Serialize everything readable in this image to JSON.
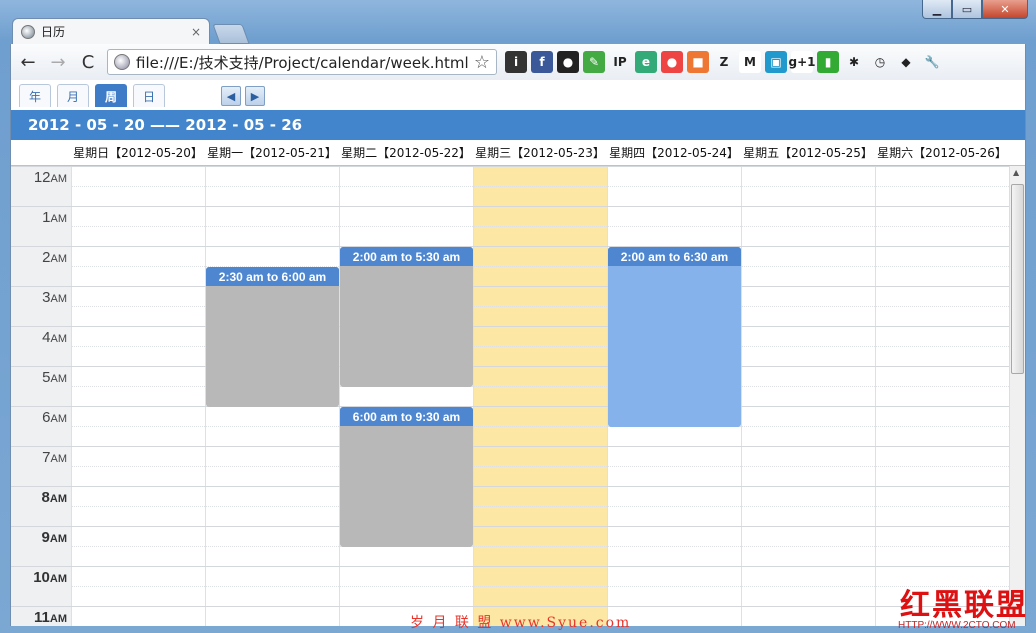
{
  "browser": {
    "tab_title": "日历",
    "tab_close": "×",
    "url": "file:///E:/技术支持/Project/calendar/week.html",
    "back": "←",
    "forward": "→",
    "reload": "C",
    "star": "☆",
    "window_min": "▁",
    "window_max": "▭",
    "window_close": "✕",
    "extensions": [
      {
        "name": "i-icon",
        "text": "i",
        "bg": "#333"
      },
      {
        "name": "f-counter-icon",
        "text": "f",
        "bg": "#3b5998"
      },
      {
        "name": "camera-icon",
        "text": "●",
        "bg": "#222"
      },
      {
        "name": "edit-icon",
        "text": "✎",
        "bg": "#4a4"
      },
      {
        "name": "ip-icon",
        "text": "IP",
        "bg": "transparent"
      },
      {
        "name": "ie-icon",
        "text": "e",
        "bg": "#3a7"
      },
      {
        "name": "record-icon",
        "text": "●",
        "bg": "#e44"
      },
      {
        "name": "color-icon",
        "text": "■",
        "bg": "#e73"
      },
      {
        "name": "z-icon",
        "text": "Z",
        "bg": "transparent"
      },
      {
        "name": "gmail-icon",
        "text": "M",
        "bg": "#fff"
      },
      {
        "name": "calendar-icon",
        "text": "▣",
        "bg": "#29c"
      },
      {
        "name": "gplus-icon",
        "text": "g+1",
        "bg": "#fff"
      },
      {
        "name": "battery-icon",
        "text": "▮",
        "bg": "#3a3"
      },
      {
        "name": "bug-icon",
        "text": "✱",
        "bg": "transparent"
      },
      {
        "name": "timer-icon",
        "text": "◷",
        "bg": "transparent"
      },
      {
        "name": "cat-icon",
        "text": "◆",
        "bg": "transparent"
      },
      {
        "name": "wrench-icon",
        "text": "🔧",
        "bg": "transparent"
      }
    ]
  },
  "views": {
    "year": "年",
    "month": "月",
    "week": "周",
    "day": "日",
    "prev": "◀",
    "next": "▶"
  },
  "range_title": "2012 - 05 - 20 —— 2012 - 05 - 26",
  "days": [
    "星期日【2012-05-20】",
    "星期一【2012-05-21】",
    "星期二【2012-05-22】",
    "星期三【2012-05-23】",
    "星期四【2012-05-24】",
    "星期五【2012-05-25】",
    "星期六【2012-05-26】"
  ],
  "today_index": 3,
  "hours": [
    {
      "num": "12",
      "suffix": "AM",
      "bold": false
    },
    {
      "num": "1",
      "suffix": "AM",
      "bold": false
    },
    {
      "num": "2",
      "suffix": "AM",
      "bold": false
    },
    {
      "num": "3",
      "suffix": "AM",
      "bold": false
    },
    {
      "num": "4",
      "suffix": "AM",
      "bold": false
    },
    {
      "num": "5",
      "suffix": "AM",
      "bold": false
    },
    {
      "num": "6",
      "suffix": "AM",
      "bold": false
    },
    {
      "num": "7",
      "suffix": "AM",
      "bold": false
    },
    {
      "num": "8",
      "suffix": "AM",
      "bold": true
    },
    {
      "num": "9",
      "suffix": "AM",
      "bold": true
    },
    {
      "num": "10",
      "suffix": "AM",
      "bold": true
    },
    {
      "num": "11",
      "suffix": "AM",
      "bold": true
    }
  ],
  "events": [
    {
      "day": 1,
      "start": 2.5,
      "end": 6.0,
      "label": "2:30 am to 6:00 am",
      "style": "gray"
    },
    {
      "day": 2,
      "start": 2.0,
      "end": 5.5,
      "label": "2:00 am to 5:30 am",
      "style": "gray"
    },
    {
      "day": 2,
      "start": 6.0,
      "end": 9.5,
      "label": "6:00 am to 9:30 am",
      "style": "gray"
    },
    {
      "day": 4,
      "start": 2.0,
      "end": 6.5,
      "label": "2:00 am to 6:30 am",
      "style": "blue"
    }
  ],
  "watermark": "岁 月 联 盟   www.Syue.com",
  "logo_text": "红黑联盟",
  "logo_url": "HTTP://WWW.2CTO.COM"
}
